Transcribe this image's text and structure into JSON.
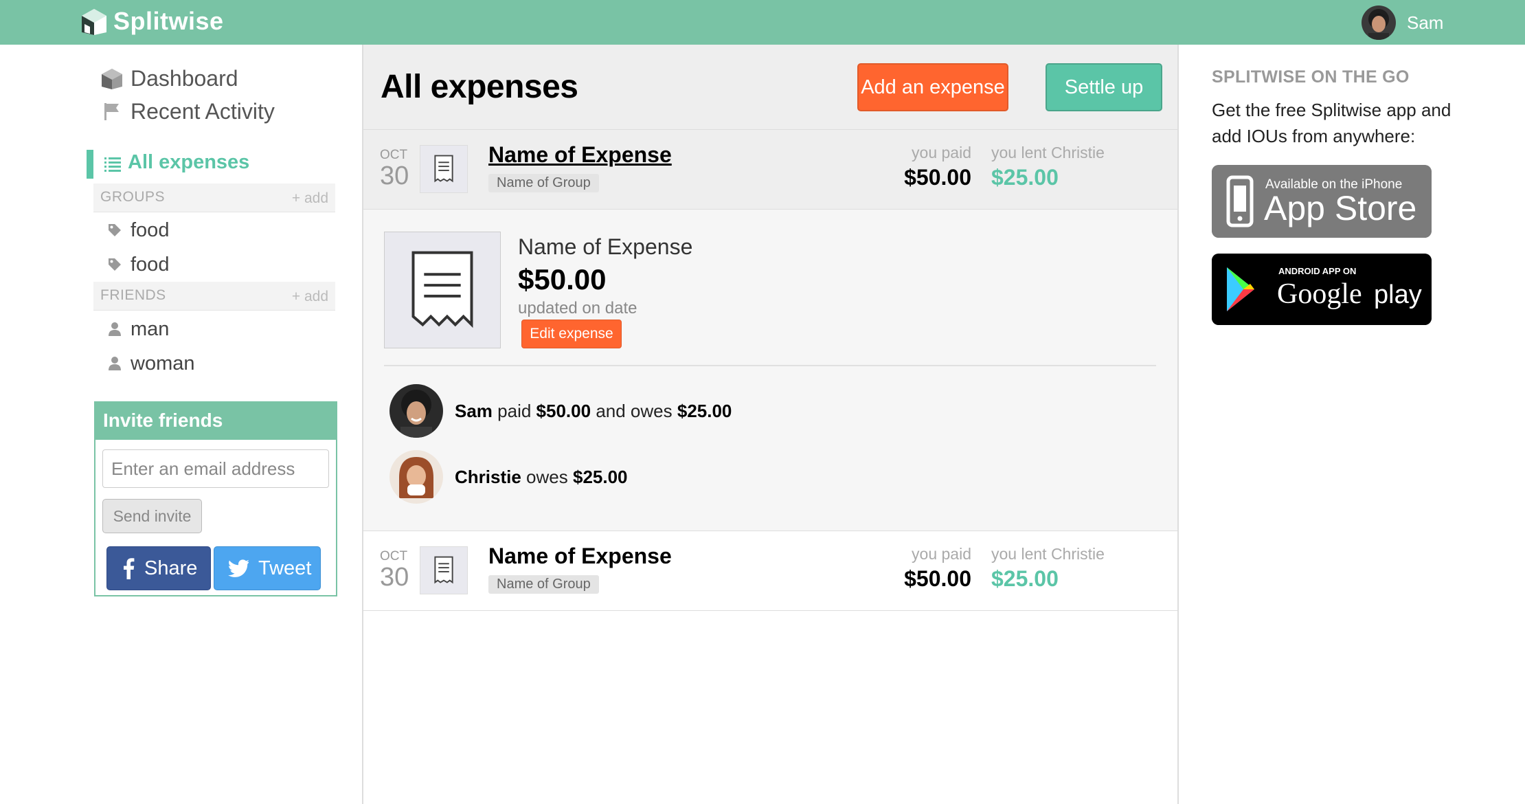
{
  "header": {
    "brand": "Splitwise",
    "user_name": "Sam"
  },
  "sidebar": {
    "dashboard": "Dashboard",
    "recent_activity": "Recent Activity",
    "all_expenses": "All expenses",
    "groups_title": "GROUPS",
    "friends_title": "FRIENDS",
    "add_label": "+ add",
    "groups": [
      "food",
      "food"
    ],
    "friends": [
      "man",
      "woman"
    ]
  },
  "invite": {
    "title": "Invite friends",
    "placeholder": "Enter an email address",
    "send_label": "Send invite"
  },
  "social": {
    "share_label": "Share",
    "tweet_label": "Tweet"
  },
  "main": {
    "title": "All expenses",
    "add_expense_label": "Add an expense",
    "settle_up_label": "Settle up",
    "expenses": [
      {
        "month": "OCT",
        "day": "30",
        "name": "Name of Expense",
        "group": "Name of Group",
        "paid_label": "you paid",
        "paid_value": "$50.00",
        "lent_label": "you lent Christie",
        "lent_value": "$25.00"
      },
      {
        "month": "OCT",
        "day": "30",
        "name": "Name of Expense",
        "group": "Name of Group",
        "paid_label": "you paid",
        "paid_value": "$50.00",
        "lent_label": "you lent Christie",
        "lent_value": "$25.00"
      }
    ],
    "detail": {
      "name": "Name of Expense",
      "amount": "$50.00",
      "updated": "updated on date",
      "edit_label": "Edit expense",
      "sam_name": "Sam",
      "sam_paid_word": "paid",
      "sam_paid": "$50.00",
      "sam_owes_word": "and owes",
      "sam_owes": "$25.00",
      "christie_name": "Christie",
      "christie_owes_word": "owes",
      "christie_owes": "$25.00"
    }
  },
  "right": {
    "title": "SPLITWISE ON THE GO",
    "text": "Get the free Splitwise app and add IOUs from anywhere:",
    "appstore_small": "Available on the iPhone",
    "appstore_big": "App Store",
    "google_small": "ANDROID APP ON",
    "google_big_1": "Google",
    "google_big_2": "play"
  },
  "colors": {
    "header_green": "#79c3a5",
    "accent_green": "#5bc5a7",
    "orange": "#ff652f",
    "facebook": "#3b5998",
    "twitter": "#4da6f0"
  }
}
